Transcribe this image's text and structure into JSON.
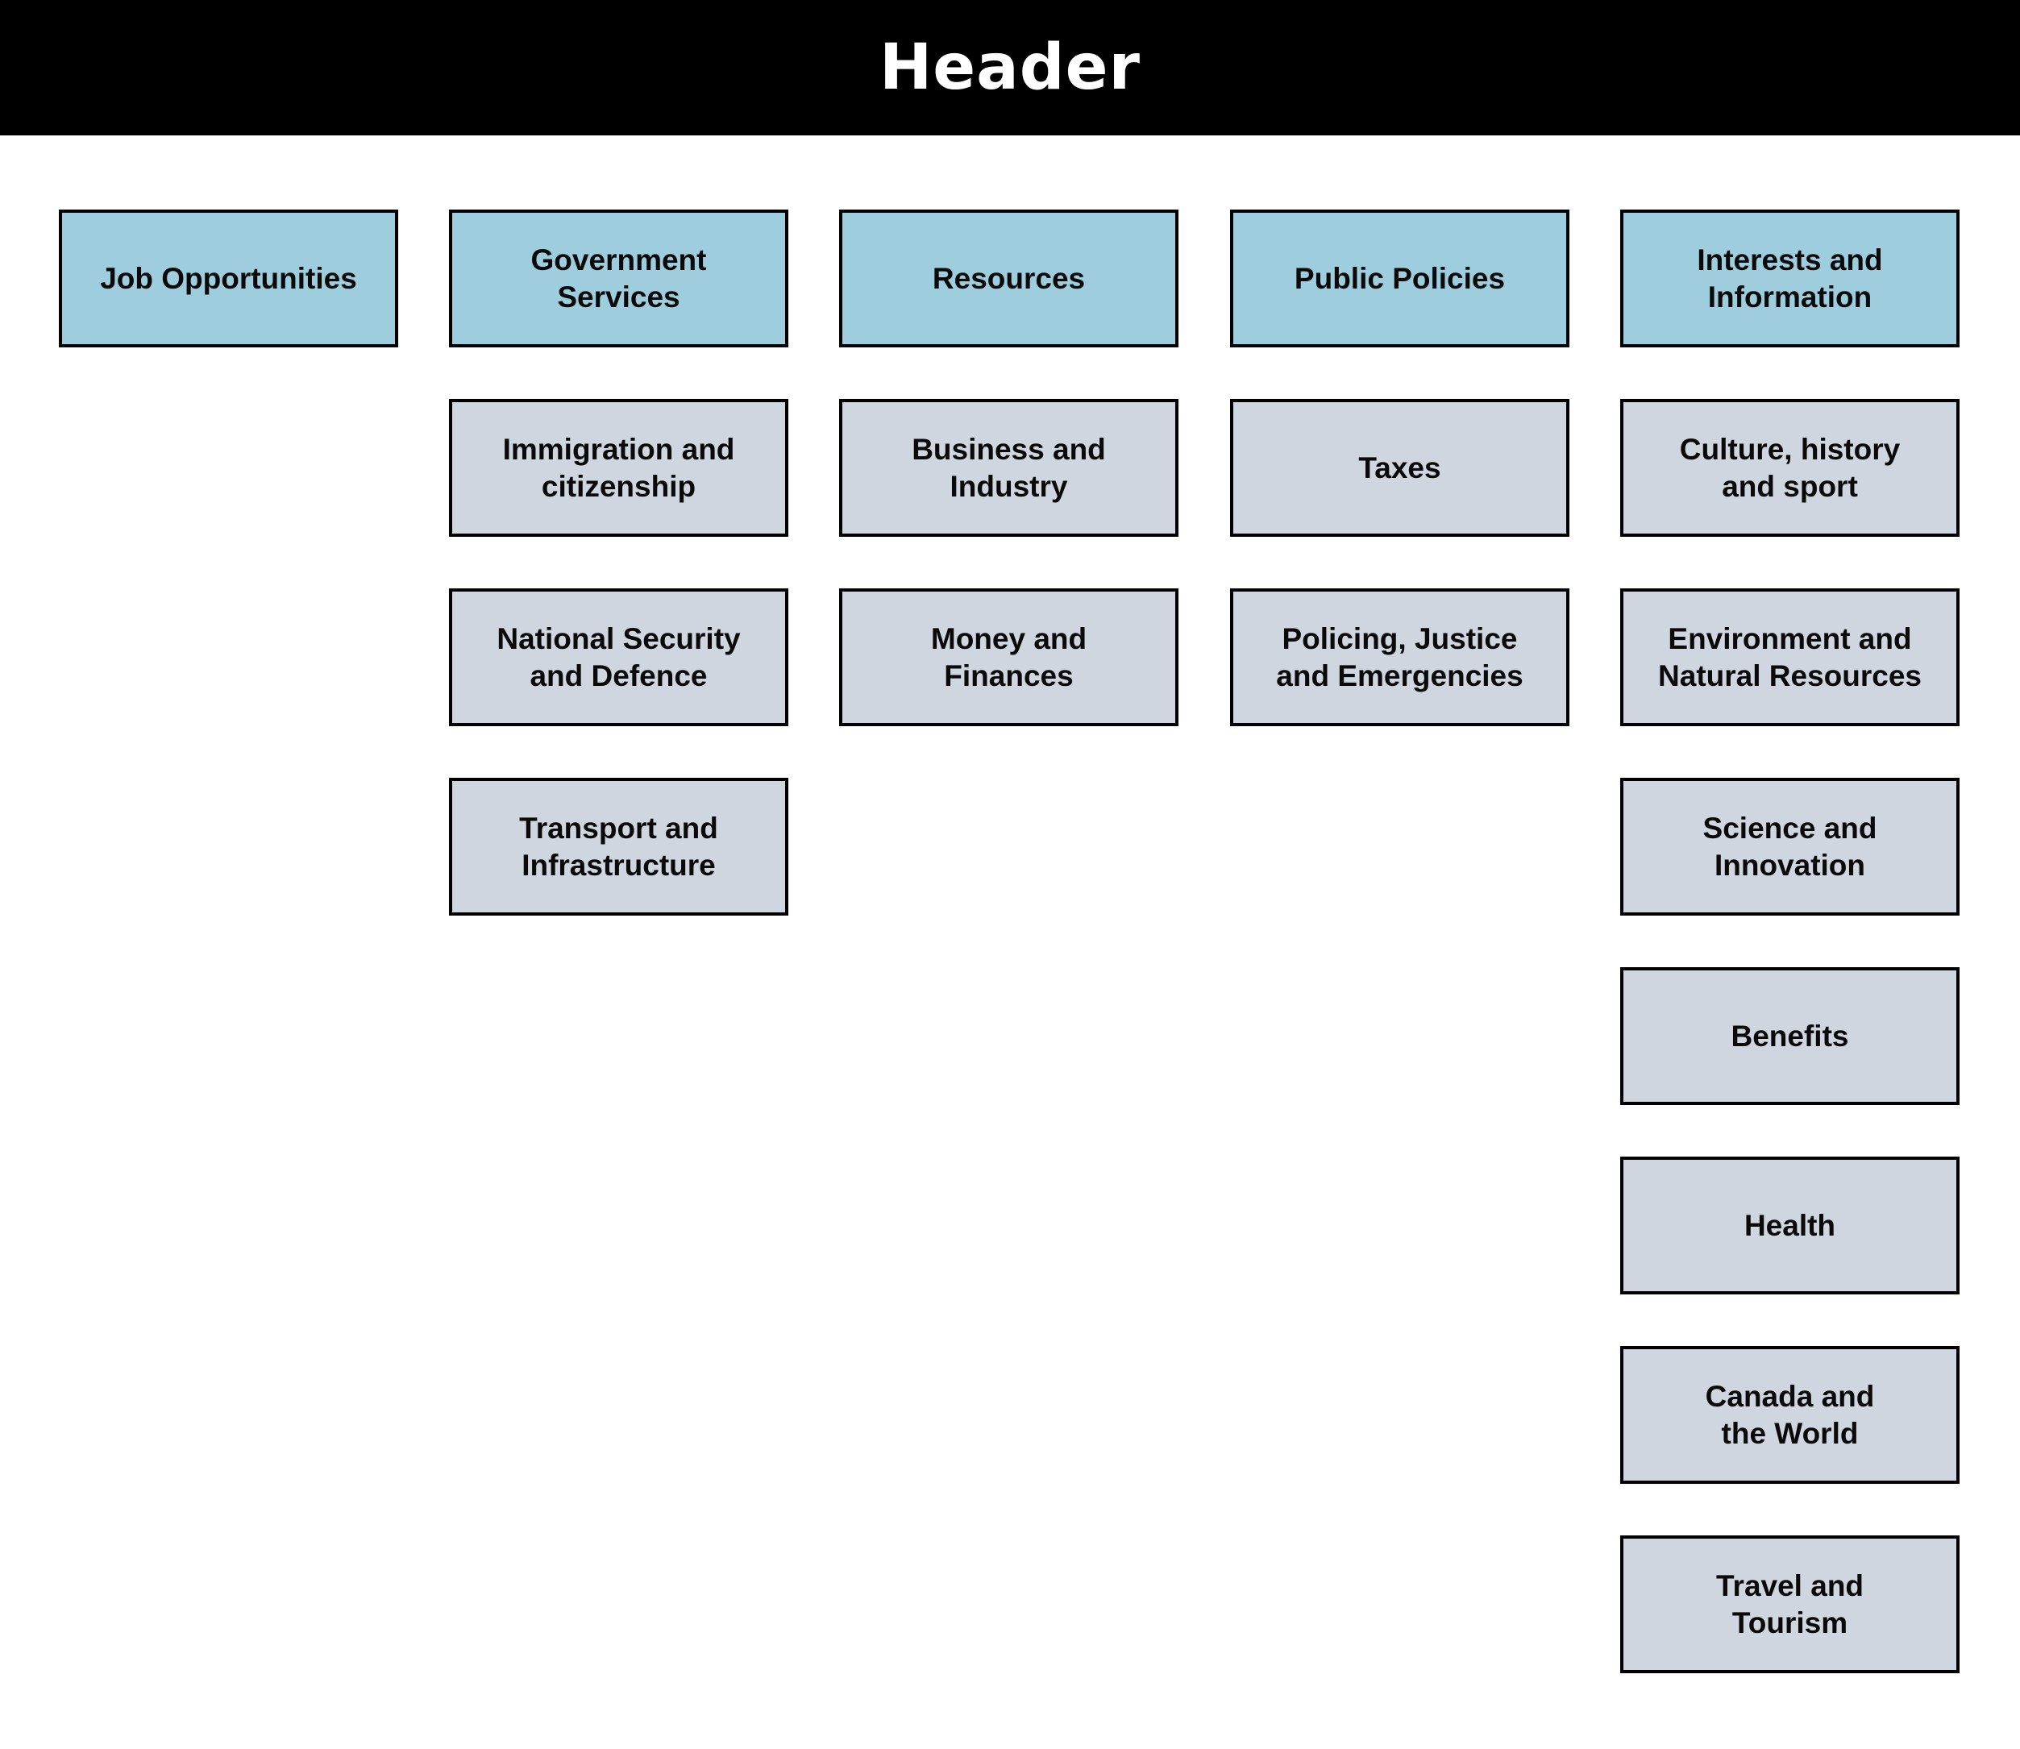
{
  "header": {
    "title": "Header"
  },
  "colors": {
    "header_bg": "#000000",
    "primary_box": "#9ECDDD",
    "secondary_box": "#CFD6DF",
    "border": "#000000"
  },
  "columns": [
    {
      "title": "Job Opportunities",
      "items": []
    },
    {
      "title": "Government\nServices",
      "items": [
        "Immigration and\ncitizenship",
        "National Security\nand Defence",
        "Transport and\nInfrastructure"
      ]
    },
    {
      "title": "Resources",
      "items": [
        "Business and\nIndustry",
        "Money and\nFinances"
      ]
    },
    {
      "title": "Public Policies",
      "items": [
        "Taxes",
        "Policing, Justice\nand Emergencies"
      ]
    },
    {
      "title": "Interests and\nInformation",
      "items": [
        "Culture, history\nand sport",
        "Environment and\nNatural Resources",
        "Science and\nInnovation",
        "Benefits",
        "Health",
        "Canada and\nthe World",
        "Travel and\nTourism"
      ]
    }
  ]
}
